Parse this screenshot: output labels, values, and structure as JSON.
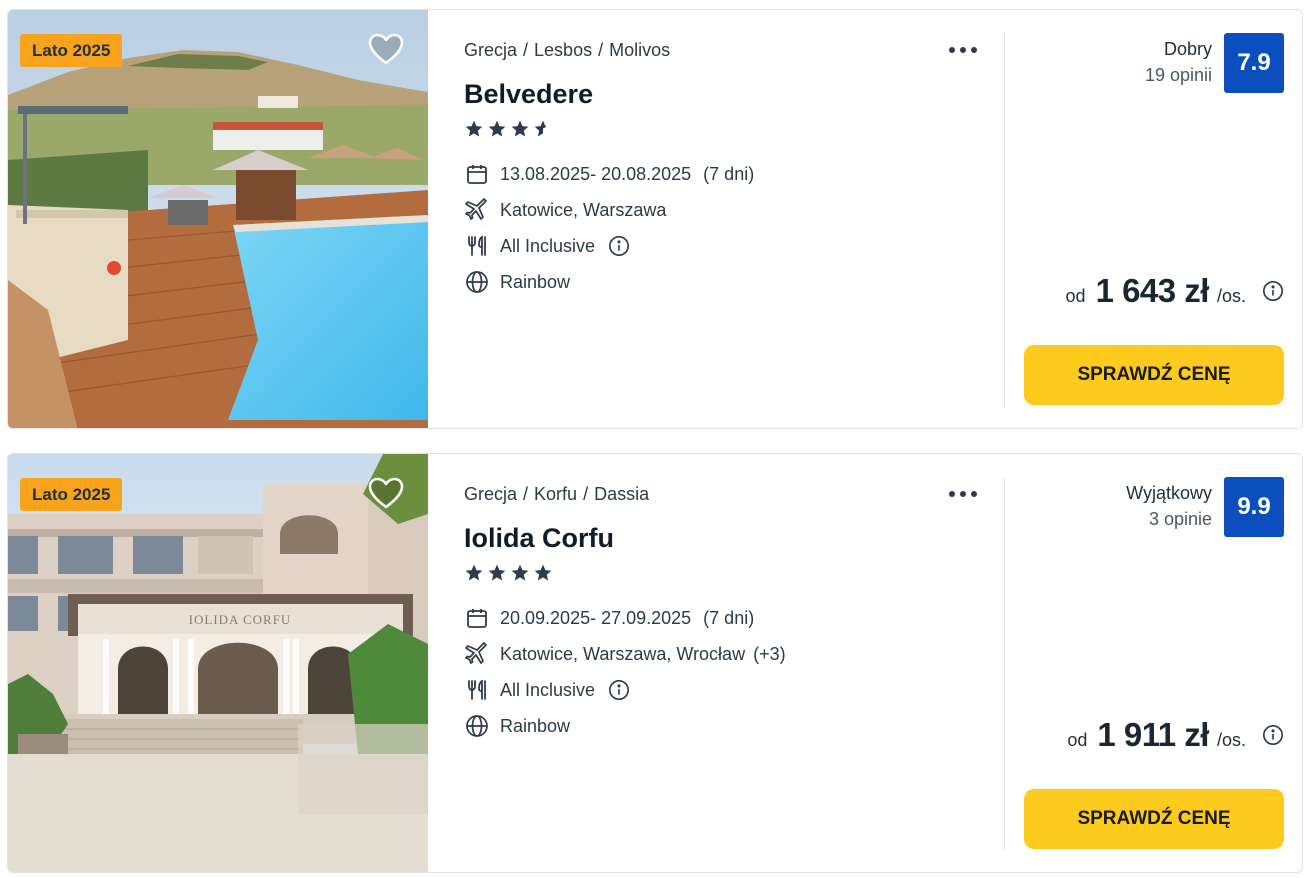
{
  "offers": [
    {
      "badge": "Lato 2025",
      "location": [
        "Grecja",
        "Lesbos",
        "Molivos"
      ],
      "location_separator": "/",
      "name": "Belvedere",
      "stars": 3.5,
      "dates": "13.08.2025- 20.08.2025",
      "duration": "(7 dni)",
      "departures": "Katowice, Warszawa",
      "departures_extra": "",
      "board": "All Inclusive",
      "operator": "Rainbow",
      "rating_label": "Dobry",
      "rating_count": "19 opinii",
      "score": "7.9",
      "price_prefix": "od",
      "price": "1 643 zł",
      "price_suffix": "/os.",
      "cta": "SPRAWDŹ CENĘ"
    },
    {
      "badge": "Lato 2025",
      "location": [
        "Grecja",
        "Korfu",
        "Dassia"
      ],
      "location_separator": "/",
      "name": "Iolida Corfu",
      "stars": 4,
      "dates": "20.09.2025- 27.09.2025",
      "duration": "(7 dni)",
      "departures": "Katowice, Warszawa, Wrocław",
      "departures_extra": "(+3)",
      "board": "All Inclusive",
      "operator": "Rainbow",
      "rating_label": "Wyjątkowy",
      "rating_count": "3 opinie",
      "score": "9.9",
      "price_prefix": "od",
      "price": "1 911 zł",
      "price_suffix": "/os.",
      "cta": "SPRAWDŹ CENĘ",
      "photo_sign": "IOLIDA CORFU"
    }
  ],
  "icons": {
    "favorite": "heart-outline-icon",
    "more": "more-dots-icon",
    "star": "star-icon",
    "date": "calendar-icon",
    "flight": "plane-icon",
    "board": "cutlery-icon",
    "operator": "globe-icon",
    "info": "info-circle-icon"
  },
  "colors": {
    "badge": "#f8a31b",
    "score": "#0a4fbd",
    "cta": "#fdcb1e",
    "stars": "#2d3b4d",
    "text": "#1f2d3d",
    "border": "#dfe3e8"
  }
}
